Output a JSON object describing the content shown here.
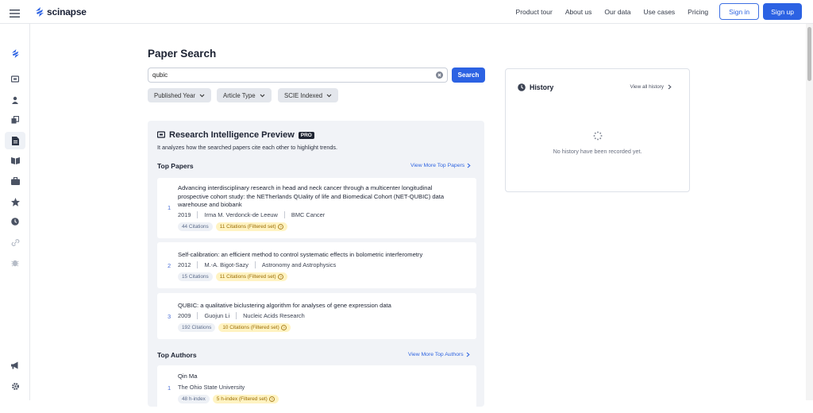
{
  "brand": {
    "name": "scinapse"
  },
  "nav": {
    "items": [
      "Product tour",
      "About us",
      "Our data",
      "Use cases",
      "Pricing"
    ],
    "signin": "Sign in",
    "signup": "Sign up"
  },
  "search": {
    "title": "Paper Search",
    "query": "qubic",
    "button": "Search",
    "filters": [
      "Published Year",
      "Article Type",
      "SCIE Indexed"
    ]
  },
  "intel": {
    "title": "Research Intelligence Preview",
    "badge": "PRO",
    "desc": "It analyzes how the searched papers cite each other to highlight trends.",
    "top_papers_title": "Top Papers",
    "top_papers_more": "View More Top Papers",
    "papers": [
      {
        "rank": "1",
        "title": "Advancing interdisciplinary research in head and neck cancer through a multicenter longitudinal prospective cohort study: the NETherlands QUality of life and Biomedical Cohort (NET-QUBIC) data warehouse and biobank",
        "year": "2019",
        "author": "Irma M. Verdonck-de Leeuw",
        "venue": "BMC Cancer",
        "citations": "44 Citations",
        "filtered": "11 Citations (Filtered set)"
      },
      {
        "rank": "2",
        "title": "Self-calibration: an efficient method to control systematic effects in bolometric interferometry",
        "year": "2012",
        "author": "M.-A. Bigot-Sazy",
        "venue": "Astronomy and Astrophysics",
        "citations": "15 Citations",
        "filtered": "11 Citations (Filtered set)"
      },
      {
        "rank": "3",
        "title": "QUBIC: a qualitative biclustering algorithm for analyses of gene expression data",
        "year": "2009",
        "author": "Guojun Li",
        "venue": "Nucleic Acids Research",
        "citations": "192 Citations",
        "filtered": "10 Citations (Filtered set)"
      }
    ],
    "top_authors_title": "Top Authors",
    "top_authors_more": "View More Top Authors",
    "authors": [
      {
        "rank": "1",
        "name": "Qin Ma",
        "affiliation": "The Ohio State University",
        "hindex": "48 h-index",
        "filtered": "5 h-index (Filtered set)"
      }
    ]
  },
  "history": {
    "title": "History",
    "view_all": "View all history",
    "empty": "No history have been recorded yet."
  },
  "colors": {
    "primary": "#2c62e3",
    "panel_bg": "#f1f3f7",
    "filtered_tag_bg": "#fff3c2"
  }
}
